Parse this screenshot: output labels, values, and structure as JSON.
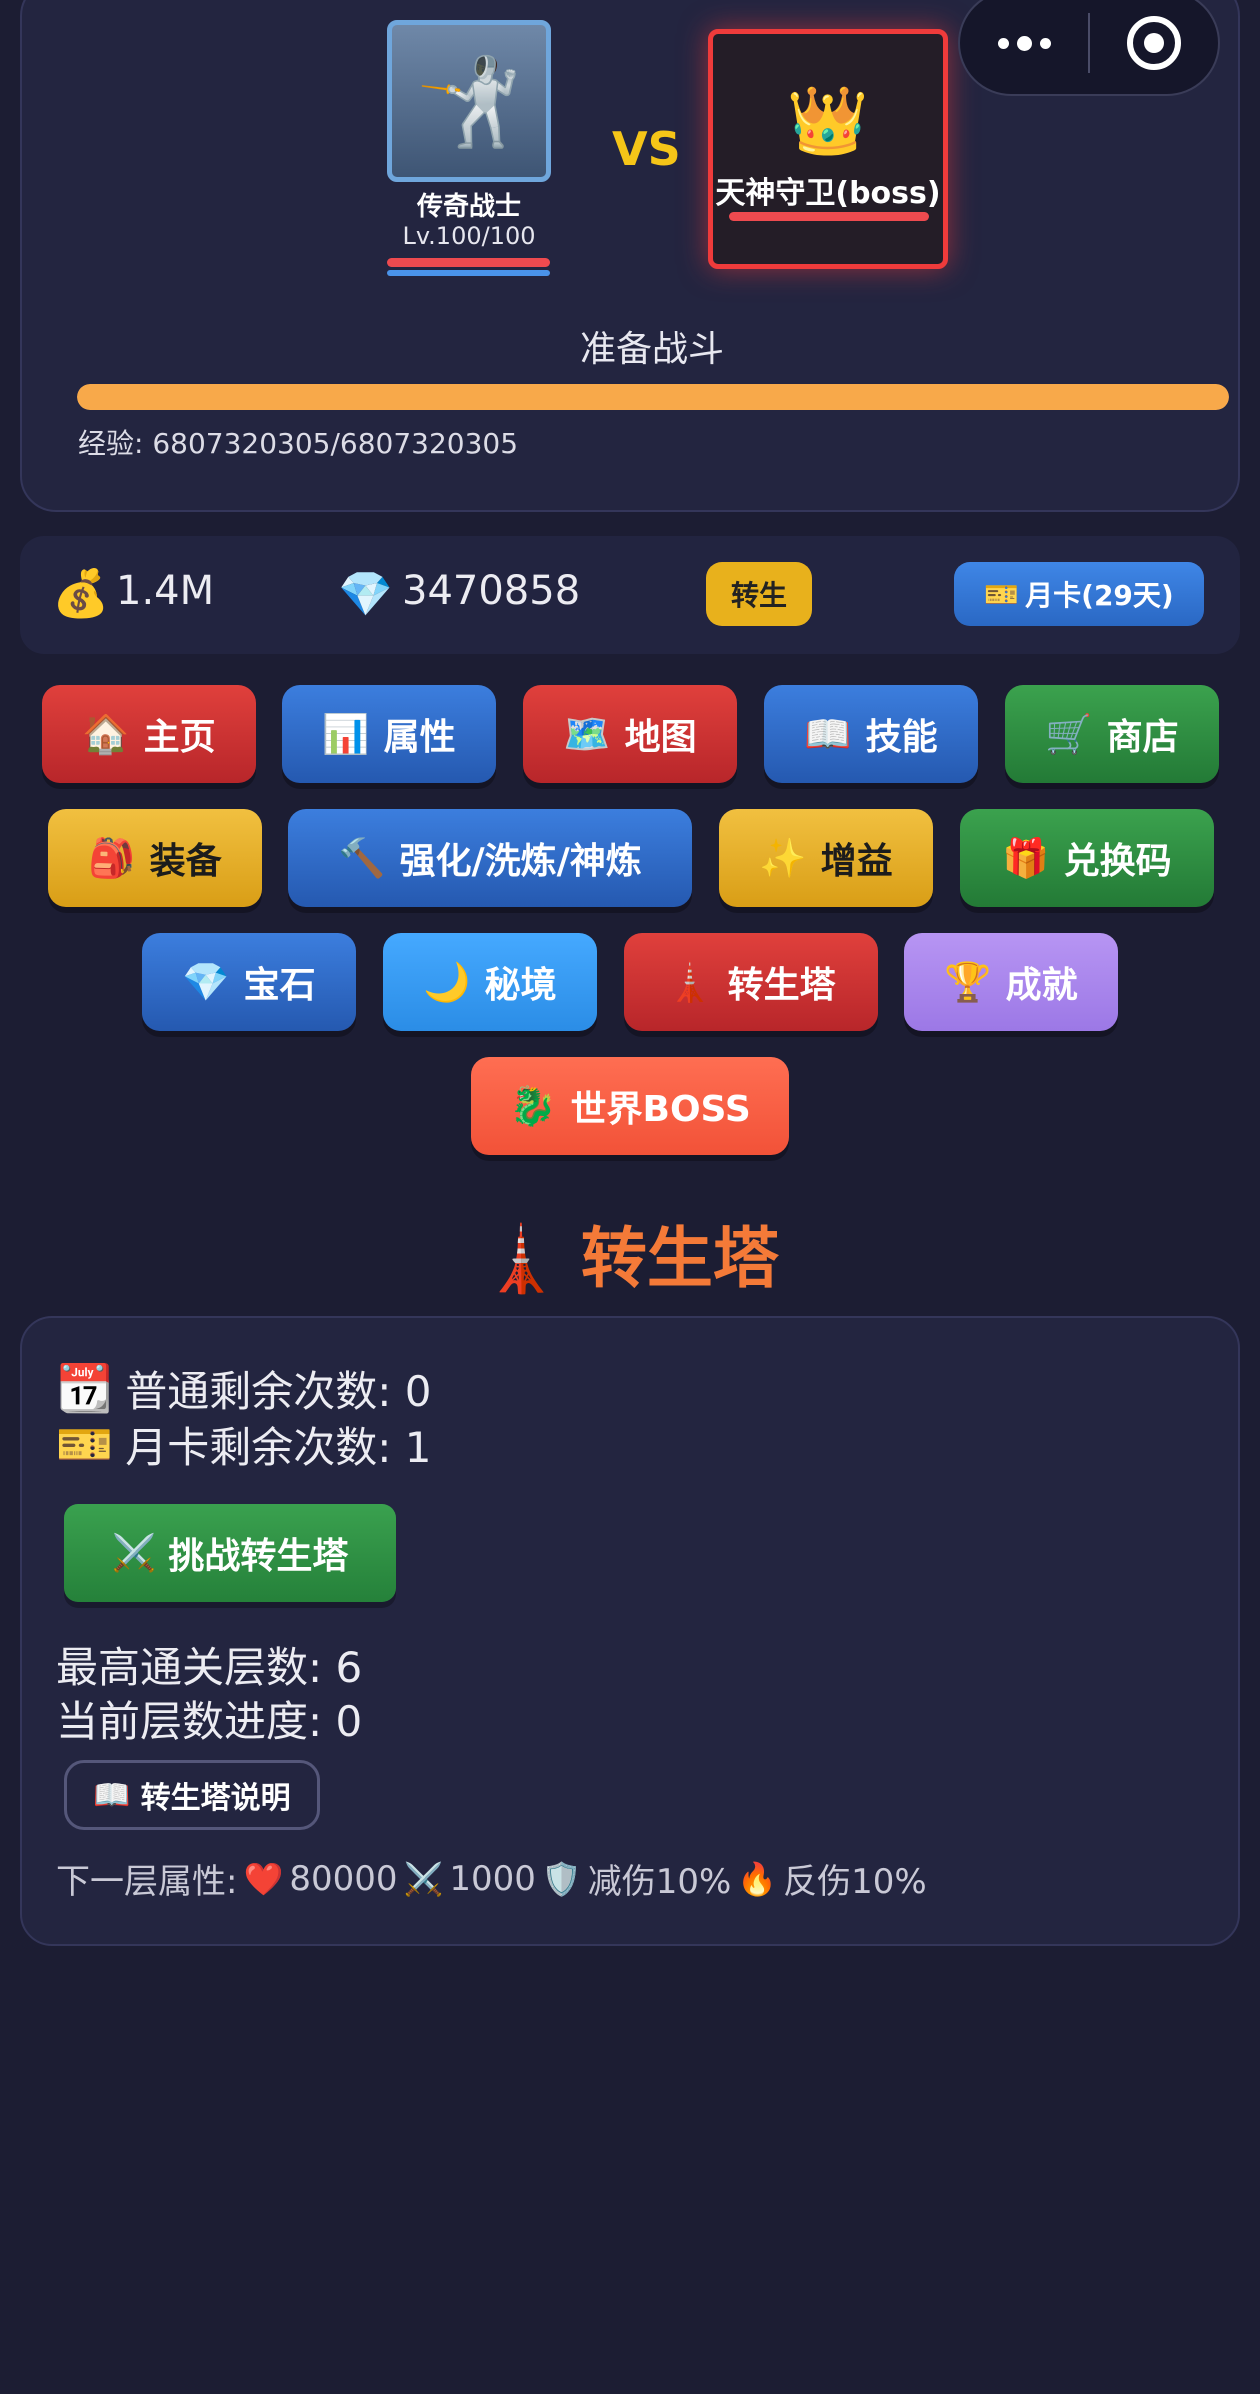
{
  "capsule": {
    "more_icon": "more-dots-icon",
    "close_icon": "target-circle-icon"
  },
  "player": {
    "avatar_icon": "fencer-icon",
    "avatar_glyph": "🤺",
    "name": "传奇战士",
    "level": "Lv.100/100"
  },
  "vs": "VS",
  "boss": {
    "avatar_icon": "crown-icon",
    "avatar_glyph": "👑",
    "name": "天神守卫(boss)"
  },
  "battle_status": "准备战斗",
  "exp": {
    "text": "经验: 6807320305/6807320305",
    "progress_percent": 100
  },
  "currency": {
    "gold_icon": "money-bag-icon",
    "gold_glyph": "💰",
    "gold": "1.4M",
    "gem_icon": "gem-icon",
    "gem_glyph": "💎",
    "gems": "3470858"
  },
  "rebirth_label": "转生",
  "monthcard": {
    "icon": "ticket-icon",
    "glyph": "🎫",
    "label": "月卡(29天)"
  },
  "nav": {
    "home": {
      "glyph": "🏠",
      "label": "主页"
    },
    "attributes": {
      "glyph": "📊",
      "label": "属性"
    },
    "map": {
      "glyph": "🗺️",
      "label": "地图"
    },
    "skills": {
      "glyph": "📖",
      "label": "技能"
    },
    "shop": {
      "glyph": "🛒",
      "label": "商店"
    },
    "equipment": {
      "glyph": "🎒",
      "label": "装备"
    },
    "enhance": {
      "glyph": "🔨",
      "label": "强化/洗炼/神炼"
    },
    "buff": {
      "glyph": "✨",
      "label": "增益"
    },
    "redeem": {
      "glyph": "🎁",
      "label": "兑换码"
    },
    "gems": {
      "glyph": "💎",
      "label": "宝石"
    },
    "secret_realm": {
      "glyph": "🌙",
      "label": "秘境"
    },
    "rebirth_tower": {
      "glyph": "🗼",
      "label": "转生塔"
    },
    "achievements": {
      "glyph": "🏆",
      "label": "成就"
    },
    "world_boss": {
      "glyph": "🐉",
      "label": "世界BOSS"
    }
  },
  "section": {
    "glyph": "🗼",
    "title": "转生塔"
  },
  "tower": {
    "normal_glyph": "📆",
    "normal_remaining": "普通剩余次数: 0",
    "card_glyph": "🎫",
    "card_remaining": "月卡剩余次数: 1",
    "challenge_glyph": "⚔️",
    "challenge_label": "挑战转生塔",
    "highest_floor": "最高通关层数: 6",
    "current_progress": "当前层数进度: 0",
    "info_glyph": "📖",
    "info_label": "转生塔说明",
    "next_floor": {
      "prefix": "下一层属性:",
      "hp_glyph": "❤️",
      "hp": "80000",
      "atk_glyph": "⚔️",
      "atk": "1000",
      "def_glyph": "🛡️",
      "def": "减伤10%",
      "reflect_glyph": "🔥",
      "reflect": "反伤10%"
    }
  }
}
